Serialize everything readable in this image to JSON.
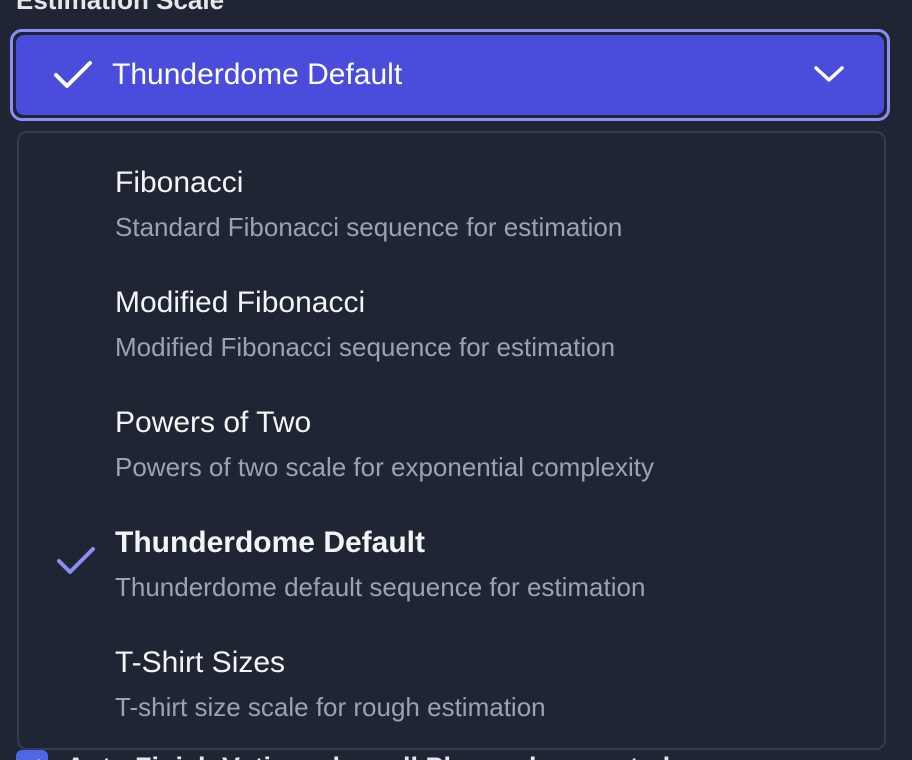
{
  "field": {
    "label": "Estimation Scale"
  },
  "select": {
    "selected_label": "Thunderdome Default",
    "check_icon": "check-icon",
    "chevron_icon": "chevron-down-icon",
    "accent_color": "#4a4ddc"
  },
  "options": [
    {
      "title": "Fibonacci",
      "description": "Standard Fibonacci sequence for estimation",
      "selected": false
    },
    {
      "title": "Modified Fibonacci",
      "description": "Modified Fibonacci sequence for estimation",
      "selected": false
    },
    {
      "title": "Powers of Two",
      "description": "Powers of two scale for exponential complexity",
      "selected": false
    },
    {
      "title": "Thunderdome Default",
      "description": "Thunderdome default sequence for estimation",
      "selected": true
    },
    {
      "title": "T-Shirt Sizes",
      "description": "T-shirt size scale for rough estimation",
      "selected": false
    }
  ],
  "auto_finish": {
    "label": "Auto Finish Voting when all Players have voted",
    "checked": true
  }
}
